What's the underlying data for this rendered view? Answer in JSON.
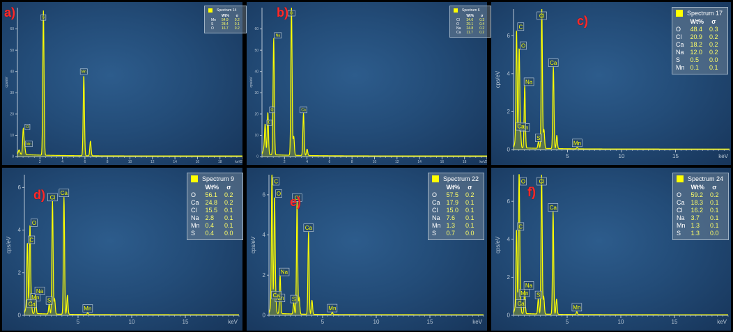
{
  "colors": {
    "spectrum": "#ffff00",
    "label": "#ff2a2a",
    "axis": "#b8c6d4"
  },
  "chart_data": [
    {
      "type": "line",
      "label": "a)",
      "legend_title": "Spectrum 14",
      "scale": "small",
      "xlabel": "keV",
      "ylabel": "cps/eV",
      "xlim": [
        0,
        20
      ],
      "xticks": [
        2,
        4,
        6,
        8,
        10,
        12,
        14,
        16,
        18,
        20
      ],
      "ylim": [
        0,
        70
      ],
      "yticks": [
        0,
        10,
        20,
        30,
        40,
        50,
        60
      ],
      "peaks": [
        {
          "x": 0.52,
          "y": 12,
          "label": "O"
        },
        {
          "x": 0.64,
          "y": 4,
          "label": "Mn"
        },
        {
          "x": 2.31,
          "y": 68,
          "label": "S"
        },
        {
          "x": 5.9,
          "y": 38,
          "label": "Mn"
        },
        {
          "x": 6.49,
          "y": 7,
          "label": ""
        }
      ],
      "table": {
        "headers": [
          "",
          "Wt%",
          "σ"
        ],
        "rows": [
          [
            "Mn",
            "54.9",
            "0.2"
          ],
          [
            "S",
            "28.4",
            "0.1"
          ],
          [
            "O",
            "16.7",
            "0.2"
          ]
        ]
      }
    },
    {
      "type": "line",
      "label": "b)",
      "legend_title": "Spectrum 6",
      "scale": "small",
      "xlabel": "keV",
      "ylabel": "cps/eV",
      "xlim": [
        0,
        20
      ],
      "xticks": [
        2,
        4,
        6,
        8,
        10,
        12,
        14,
        16,
        18,
        20
      ],
      "ylim": [
        0,
        70
      ],
      "yticks": [
        0,
        10,
        20,
        30,
        40,
        50,
        60
      ],
      "peaks": [
        {
          "x": 0.28,
          "y": 14,
          "label": "C"
        },
        {
          "x": 0.52,
          "y": 20,
          "label": "O"
        },
        {
          "x": 1.04,
          "y": 55,
          "label": "Na"
        },
        {
          "x": 2.62,
          "y": 70,
          "label": "Cl"
        },
        {
          "x": 2.82,
          "y": 9,
          "label": ""
        },
        {
          "x": 3.69,
          "y": 20,
          "label": "Ca"
        },
        {
          "x": 4.01,
          "y": 3,
          "label": ""
        }
      ],
      "table": {
        "headers": [
          "",
          "Wt%",
          "σ"
        ],
        "rows": [
          [
            "Cl",
            "34.6",
            "0.3"
          ],
          [
            "O",
            "29.1",
            "0.4"
          ],
          [
            "Na",
            "24.8",
            "0.2"
          ],
          [
            "Ca",
            "11.7",
            "0.2"
          ]
        ]
      }
    },
    {
      "type": "line",
      "label": "c)",
      "legend_title": "Spectrum 17",
      "scale": "big",
      "xlabel": "keV",
      "ylabel": "cps/eV",
      "xlim": [
        0,
        20
      ],
      "xticks": [
        5,
        10,
        15
      ],
      "ylim": [
        0,
        7.4
      ],
      "yticks": [
        0,
        2,
        4,
        6
      ],
      "peaks": [
        {
          "x": 0.28,
          "y": 6.2,
          "label": "C"
        },
        {
          "x": 0.52,
          "y": 5.2,
          "label": "O"
        },
        {
          "x": 0.64,
          "y": 0.9,
          "label": "Mn"
        },
        {
          "x": 1.04,
          "y": 3.3,
          "label": "Na"
        },
        {
          "x": 2.31,
          "y": 0.35,
          "label": "S"
        },
        {
          "x": 2.62,
          "y": 7.4,
          "label": "Cl"
        },
        {
          "x": 2.82,
          "y": 1.0,
          "label": ""
        },
        {
          "x": 3.69,
          "y": 4.3,
          "label": "Ca"
        },
        {
          "x": 4.01,
          "y": 0.7,
          "label": ""
        },
        {
          "x": 5.9,
          "y": 0.08,
          "label": "Mn"
        }
      ],
      "extra_tags": [
        {
          "x": 0.3,
          "y": 0.95,
          "label": "Ca"
        }
      ],
      "table": {
        "headers": [
          "",
          "Wt%",
          "σ"
        ],
        "rows": [
          [
            "O",
            "48.4",
            "0.3"
          ],
          [
            "Cl",
            "20.9",
            "0.2"
          ],
          [
            "Ca",
            "18.2",
            "0.2"
          ],
          [
            "Na",
            "12.0",
            "0.2"
          ],
          [
            "S",
            "0.5",
            "0.0"
          ],
          [
            "Mn",
            "0.1",
            "0.1"
          ]
        ]
      }
    },
    {
      "type": "line",
      "label": "d)",
      "legend_title": "Spectrum 9",
      "scale": "big",
      "xlabel": "keV",
      "ylabel": "cps/eV",
      "xlim": [
        0,
        20
      ],
      "xticks": [
        5,
        10,
        15
      ],
      "ylim": [
        0,
        6.6
      ],
      "yticks": [
        0,
        2,
        4,
        6
      ],
      "peaks": [
        {
          "x": 0.28,
          "y": 3.3,
          "label": "C"
        },
        {
          "x": 0.52,
          "y": 4.1,
          "label": "O"
        },
        {
          "x": 0.64,
          "y": 0.6,
          "label": "Mn"
        },
        {
          "x": 1.04,
          "y": 0.9,
          "label": "Na"
        },
        {
          "x": 2.31,
          "y": 0.45,
          "label": "S"
        },
        {
          "x": 2.62,
          "y": 5.3,
          "label": "Cl"
        },
        {
          "x": 2.82,
          "y": 0.7,
          "label": ""
        },
        {
          "x": 3.69,
          "y": 5.5,
          "label": "Ca"
        },
        {
          "x": 4.01,
          "y": 0.9,
          "label": ""
        },
        {
          "x": 5.9,
          "y": 0.08,
          "label": "Mn"
        }
      ],
      "extra_tags": [
        {
          "x": 0.3,
          "y": 0.3,
          "label": "Ca"
        }
      ],
      "table": {
        "headers": [
          "",
          "Wt%",
          "σ"
        ],
        "rows": [
          [
            "O",
            "56.1",
            "0.2"
          ],
          [
            "Ca",
            "24.8",
            "0.2"
          ],
          [
            "Cl",
            "15.5",
            "0.1"
          ],
          [
            "Na",
            "2.8",
            "0.1"
          ],
          [
            "Mn",
            "0.4",
            "0.1"
          ],
          [
            "S",
            "0.4",
            "0.0"
          ]
        ]
      }
    },
    {
      "type": "line",
      "label": "e)",
      "legend_title": "Spectrum 22",
      "scale": "big",
      "xlabel": "keV",
      "ylabel": "cps/eV",
      "xlim": [
        0,
        20
      ],
      "xticks": [
        5,
        10,
        15
      ],
      "ylim": [
        0,
        7.0
      ],
      "yticks": [
        0,
        2,
        4,
        6
      ],
      "peaks": [
        {
          "x": 0.28,
          "y": 7.0,
          "label": "C"
        },
        {
          "x": 0.52,
          "y": 5.8,
          "label": "O"
        },
        {
          "x": 0.64,
          "y": 0.6,
          "label": "Mn"
        },
        {
          "x": 1.04,
          "y": 1.9,
          "label": "Na"
        },
        {
          "x": 2.31,
          "y": 0.55,
          "label": "S"
        },
        {
          "x": 2.62,
          "y": 5.6,
          "label": "Cl"
        },
        {
          "x": 2.82,
          "y": 0.8,
          "label": ""
        },
        {
          "x": 3.69,
          "y": 4.1,
          "label": "Ca"
        },
        {
          "x": 4.01,
          "y": 0.7,
          "label": ""
        },
        {
          "x": 5.9,
          "y": 0.1,
          "label": "Mn"
        }
      ],
      "extra_tags": [
        {
          "x": 0.3,
          "y": 0.75,
          "label": "Ca"
        }
      ],
      "table": {
        "headers": [
          "",
          "Wt%",
          "σ"
        ],
        "rows": [
          [
            "O",
            "57.5",
            "0.2"
          ],
          [
            "Ca",
            "17.9",
            "0.1"
          ],
          [
            "Cl",
            "15.0",
            "0.1"
          ],
          [
            "Na",
            "7.6",
            "0.1"
          ],
          [
            "Mn",
            "1.3",
            "0.1"
          ],
          [
            "S",
            "0.7",
            "0.0"
          ]
        ]
      }
    },
    {
      "type": "line",
      "label": "f)",
      "legend_title": "Spectrum 24",
      "scale": "big",
      "xlabel": "keV",
      "ylabel": "cps/eV",
      "xlim": [
        0,
        20
      ],
      "xticks": [
        5,
        10,
        15
      ],
      "ylim": [
        0,
        7.4
      ],
      "yticks": [
        0,
        2,
        4,
        6
      ],
      "peaks": [
        {
          "x": 0.28,
          "y": 4.4,
          "label": "C"
        },
        {
          "x": 0.52,
          "y": 7.4,
          "label": "O"
        },
        {
          "x": 0.64,
          "y": 0.9,
          "label": "Mn"
        },
        {
          "x": 1.04,
          "y": 1.3,
          "label": "Na"
        },
        {
          "x": 2.31,
          "y": 0.8,
          "label": "S"
        },
        {
          "x": 2.62,
          "y": 7.4,
          "label": "Cl"
        },
        {
          "x": 2.82,
          "y": 0.9,
          "label": ""
        },
        {
          "x": 3.69,
          "y": 5.4,
          "label": "Ca"
        },
        {
          "x": 4.01,
          "y": 0.8,
          "label": ""
        },
        {
          "x": 5.9,
          "y": 0.15,
          "label": "Mn"
        }
      ],
      "extra_tags": [
        {
          "x": 0.3,
          "y": 0.35,
          "label": "Ca"
        }
      ],
      "table": {
        "headers": [
          "",
          "Wt%",
          "σ"
        ],
        "rows": [
          [
            "O",
            "59.2",
            "0.2"
          ],
          [
            "Ca",
            "18.3",
            "0.1"
          ],
          [
            "Cl",
            "16.2",
            "0.1"
          ],
          [
            "Na",
            "3.7",
            "0.1"
          ],
          [
            "Mn",
            "1.3",
            "0.1"
          ],
          [
            "S",
            "1.3",
            "0.0"
          ]
        ]
      }
    }
  ]
}
